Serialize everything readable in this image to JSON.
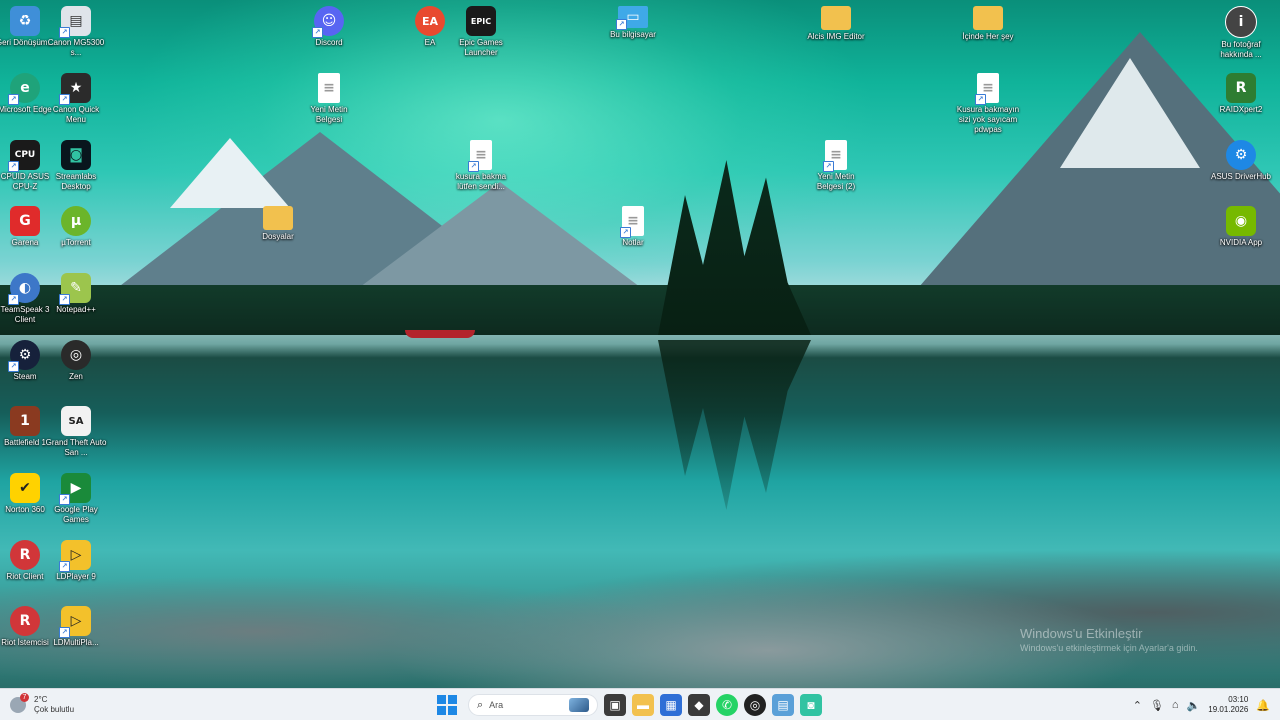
{
  "desktop_icons": [
    {
      "label": "Geri Dönüşüm...",
      "icon": "recycle-bin-icon",
      "color": "#3f8fd8"
    },
    {
      "label": "Canon MG5300 s...",
      "icon": "printer-icon",
      "color": "#dfe4ea"
    },
    {
      "label": "Microsoft Edge",
      "icon": "edge-icon",
      "color": "#1fa37a"
    },
    {
      "label": "Canon Quick Menu",
      "icon": "canon-quick-menu-icon",
      "color": "#2b2b2b"
    },
    {
      "label": "CPUID ASUS CPU-Z",
      "icon": "cpuz-icon",
      "color": "#1a1a1a"
    },
    {
      "label": "Streamlabs Desktop",
      "icon": "streamlabs-icon",
      "color": "#09161d"
    },
    {
      "label": "Garena",
      "icon": "garena-icon",
      "color": "#e02b2b"
    },
    {
      "label": "µTorrent",
      "icon": "utorrent-icon",
      "color": "#6bb52a"
    },
    {
      "label": "TeamSpeak 3 Client",
      "icon": "teamspeak-icon",
      "color": "#3d77c8"
    },
    {
      "label": "Notepad++",
      "icon": "notepadpp-icon",
      "color": "#9cc54d"
    },
    {
      "label": "Steam",
      "icon": "steam-icon",
      "color": "#16213b"
    },
    {
      "label": "Zen",
      "icon": "zen-browser-icon",
      "color": "#2a2a2a"
    },
    {
      "label": "Battlefield 1",
      "icon": "battlefield-icon",
      "color": "#8a3a20"
    },
    {
      "label": "Grand Theft Auto San ...",
      "icon": "gta-icon",
      "color": "#f2f2f2"
    },
    {
      "label": "Norton 360",
      "icon": "norton-icon",
      "color": "#ffd200"
    },
    {
      "label": "Google Play Games",
      "icon": "google-play-games-icon",
      "color": "#1a8a3a"
    },
    {
      "label": "Riot Client",
      "icon": "riot-client-icon",
      "color": "#d13639"
    },
    {
      "label": "LDPlayer 9",
      "icon": "ldplayer-icon",
      "color": "#f3c12b"
    },
    {
      "label": "Riot İstemcisi",
      "icon": "riot-client-tr-icon",
      "color": "#d13639"
    },
    {
      "label": "LDMultiPla...",
      "icon": "ldmultiplayer-icon",
      "color": "#f3c12b"
    },
    {
      "label": "Yeni Metin Belgesi",
      "icon": "text-document-icon",
      "color": "#ffffff"
    },
    {
      "label": "Dosyalar",
      "icon": "folder-icon",
      "color": "#f2c14e"
    },
    {
      "label": "Discord",
      "icon": "discord-icon",
      "color": "#5865f2"
    },
    {
      "label": "EA",
      "icon": "ea-icon",
      "color": "#e84a2f"
    },
    {
      "label": "Epic Games Launcher",
      "icon": "epic-games-icon",
      "color": "#1a1a1a"
    },
    {
      "label": "kusura bakma lütfen sendi...",
      "icon": "text-document-icon",
      "color": "#ffffff"
    },
    {
      "label": "Bu bilgisayar",
      "icon": "this-pc-icon",
      "color": "#3fa9e8"
    },
    {
      "label": "Notlar",
      "icon": "text-document-icon",
      "color": "#ffffff"
    },
    {
      "label": "Alcis IMG Editor",
      "icon": "folder-icon",
      "color": "#f2c14e"
    },
    {
      "label": "Yeni Metin Belgesi (2)",
      "icon": "text-document-icon",
      "color": "#ffffff"
    },
    {
      "label": "İçinde Her şey",
      "icon": "folder-icon",
      "color": "#f2c14e"
    },
    {
      "label": "Kusura bakmayın sizi yok sayıcam pdwpas",
      "icon": "text-document-icon",
      "color": "#ffffff"
    },
    {
      "label": "Bu fotoğraf hakkında ...",
      "icon": "photo-info-icon",
      "color": "#444444"
    },
    {
      "label": "RAIDXpert2",
      "icon": "raidxpert-icon",
      "color": "#2e7d32"
    },
    {
      "label": "ASUS DriverHub",
      "icon": "asus-driverhub-icon",
      "color": "#1e88e5"
    },
    {
      "label": "NVIDIA App",
      "icon": "nvidia-icon",
      "color": "#76b900"
    }
  ],
  "watermark": {
    "title": "Windows'u Etkinleştir",
    "subtitle": "Windows'u etkinleştirmek için Ayarlar'a gidin."
  },
  "taskbar": {
    "weather": {
      "temp": "2°C",
      "condition": "Çok bulutlu",
      "badge": "7"
    },
    "search_placeholder": "Ara",
    "apps": [
      {
        "name": "task-view-icon",
        "color": "#3b3b3b"
      },
      {
        "name": "file-explorer-icon",
        "color": "#f2c14e"
      },
      {
        "name": "microsoft-store-icon",
        "color": "#2f6fd6"
      },
      {
        "name": "cube-app-icon",
        "color": "#3a3a3a"
      },
      {
        "name": "whatsapp-icon",
        "color": "#25d366"
      },
      {
        "name": "zen-browser-icon",
        "color": "#222222"
      },
      {
        "name": "control-panel-icon",
        "color": "#5aa0d8"
      },
      {
        "name": "streamlabs-icon",
        "color": "#31c3a2"
      }
    ],
    "time": "03:10",
    "date": "19.01.2026"
  }
}
